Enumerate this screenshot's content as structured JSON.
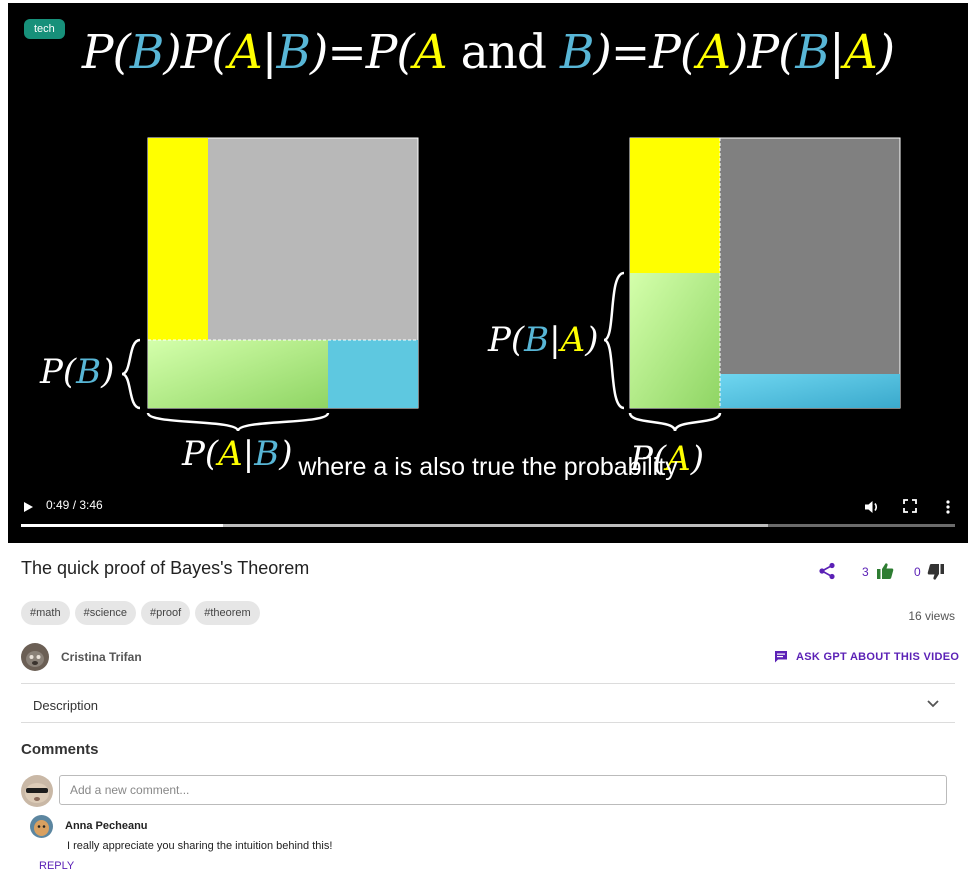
{
  "video": {
    "category_badge": "tech",
    "formula": {
      "lhs": [
        "P(",
        "B",
        ")P(",
        "A",
        "|",
        "B",
        ")"
      ],
      "mid": [
        "=P(",
        "A",
        " and ",
        "B",
        ")"
      ],
      "rhs": [
        "=P(",
        "A",
        ")P(",
        "B",
        "|",
        "A",
        ")"
      ]
    },
    "left_labels": {
      "pb": [
        "P(",
        "B",
        ")"
      ],
      "pab": [
        "P(",
        "A",
        "|",
        "B",
        ")"
      ]
    },
    "right_labels": {
      "pba": [
        "P(",
        "B",
        "|",
        "A",
        ")"
      ],
      "pa": [
        "P(",
        "A",
        ")"
      ]
    },
    "subtitle": "where a is also true the probability",
    "time_display": "0:49 / 3:46",
    "progress_fraction": 0.2168,
    "buffered_fraction": 0.8
  },
  "video_info": {
    "title": "The quick proof of Bayes's Theorem",
    "likes": "3",
    "dislikes": "0",
    "tags": [
      "#math",
      "#science",
      "#proof",
      "#theorem"
    ],
    "views": "16 views"
  },
  "author": {
    "name": "Cristina Trifan"
  },
  "ask_gpt_label": "ASK GPT ABOUT THIS VIDEO",
  "description_label": "Description",
  "comments": {
    "heading": "Comments",
    "input_placeholder": "Add a new comment...",
    "items": [
      {
        "author": "Anna Pecheanu",
        "text": "I really appreciate you sharing the intuition behind this!",
        "reply_label": "REPLY"
      }
    ]
  },
  "colors": {
    "accent": "#5b21b6",
    "badge": "#17907a",
    "yellow": "#ffff00",
    "blue": "#58b6d6",
    "green": "#a9e188"
  }
}
